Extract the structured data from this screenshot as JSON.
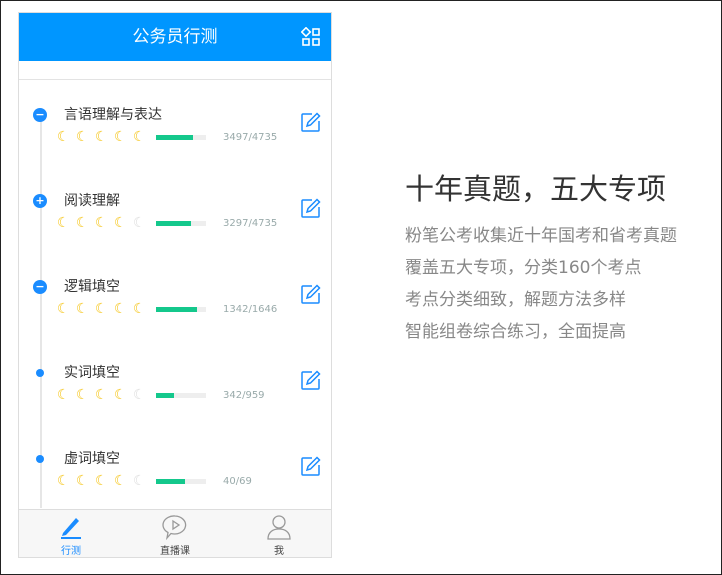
{
  "header": {
    "title": "公务员行测",
    "grid_icon": "apps-grid-icon"
  },
  "items": [
    {
      "name": "言语理解与表达",
      "count": "3497/4735",
      "level": 5,
      "progress": 0.74,
      "dot": "minus"
    },
    {
      "name": "阅读理解",
      "count": "3297/4735",
      "level": 4,
      "progress": 0.7,
      "dot": "plus"
    },
    {
      "name": "逻辑填空",
      "count": "1342/1646",
      "level": 5,
      "progress": 0.82,
      "dot": "minus"
    },
    {
      "name": "实词填空",
      "count": "342/959",
      "level": 4,
      "progress": 0.36,
      "dot": "small"
    },
    {
      "name": "虚词填空",
      "count": "40/69",
      "level": 4,
      "progress": 0.58,
      "dot": "small"
    }
  ],
  "tabs": [
    {
      "label": "行测"
    },
    {
      "label": "直播课"
    },
    {
      "label": "我"
    }
  ],
  "promo": {
    "title": "十年真题，五大专项",
    "lines": [
      "粉笔公考收集近十年国考和省考真题",
      "覆盖五大专项，分类160个考点",
      "考点分类细致，解题方法多样",
      "智能组卷综合练习，全面提高"
    ]
  },
  "colors": {
    "accent": "#0096ff",
    "progress": "#14c88c"
  }
}
